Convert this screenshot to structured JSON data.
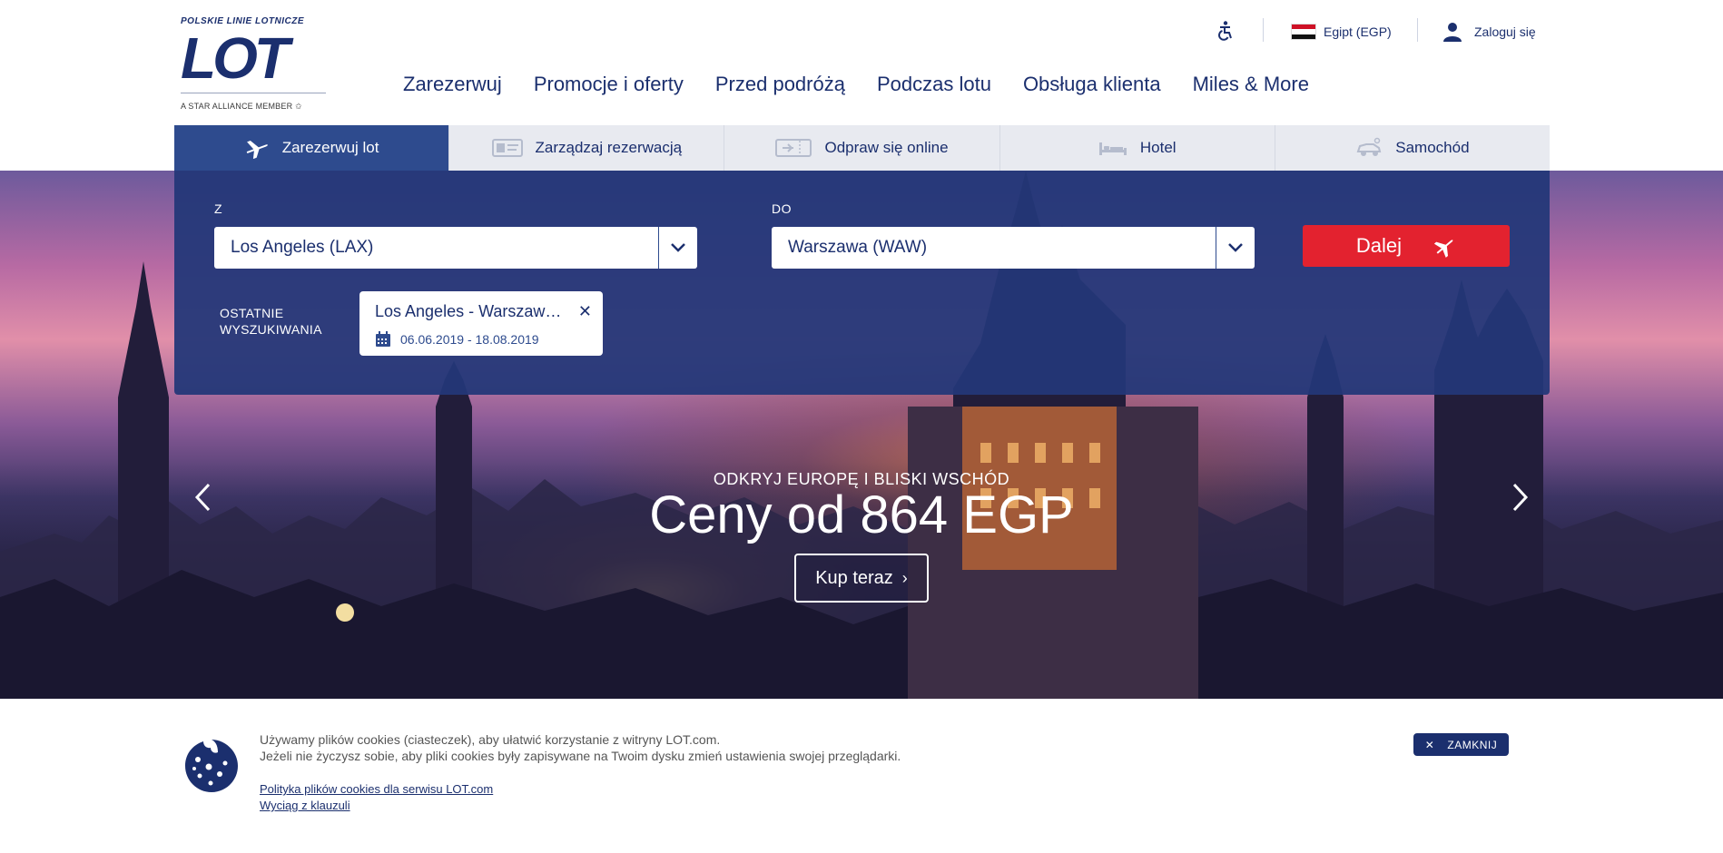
{
  "logo": {
    "airline_line": "POLSKIE LINIE LOTNICZE",
    "mark": "LOT",
    "alliance": "A STAR ALLIANCE MEMBER"
  },
  "utility": {
    "country": "Egipt (EGP)",
    "login": "Zaloguj się"
  },
  "main_nav": [
    "Zarezerwuj",
    "Promocje i oferty",
    "Przed podróżą",
    "Podczas lotu",
    "Obsługa klienta",
    "Miles & More"
  ],
  "tabs": [
    {
      "label": "Zarezerwuj lot",
      "icon": "plane-icon",
      "active": true
    },
    {
      "label": "Zarządzaj rezerwacją",
      "icon": "id-card-icon",
      "active": false
    },
    {
      "label": "Odpraw się online",
      "icon": "boarding-pass-icon",
      "active": false
    },
    {
      "label": "Hotel",
      "icon": "bed-icon",
      "active": false
    },
    {
      "label": "Samochód",
      "icon": "car-icon",
      "active": false
    }
  ],
  "search": {
    "from_label": "Z",
    "from_value": "Los Angeles (LAX)",
    "to_label": "DO",
    "to_value": "Warszawa (WAW)",
    "submit_label": "Dalej",
    "recent_label_line1": "OSTATNIE",
    "recent_label_line2": "WYSZUKIWANIA",
    "recent_route": "Los Angeles - Warszawa (WAW)",
    "recent_dates": "06.06.2019 - 18.08.2019"
  },
  "promo": {
    "kicker": "ODKRYJ EUROPĘ I BLISKI WSCHÓD",
    "title": "Ceny od 864 EGP",
    "button": "Kup teraz"
  },
  "cookies": {
    "line1": "Używamy plików cookies (ciasteczek), aby ułatwić korzystanie z witryny LOT.com.",
    "line2": "Jeżeli nie życzysz sobie, aby pliki cookies były zapisywane na Twoim dysku zmień ustawienia swojej przeglądarki.",
    "policy_link": "Polityka plików cookies dla serwisu LOT.com",
    "clause_link": "Wyciąg z klauzuli",
    "close_label": "ZAMKNIJ"
  },
  "colors": {
    "brand_navy": "#1b2f6e",
    "panel_blue": "#2e4b8e",
    "cta_red": "#e3222f"
  }
}
